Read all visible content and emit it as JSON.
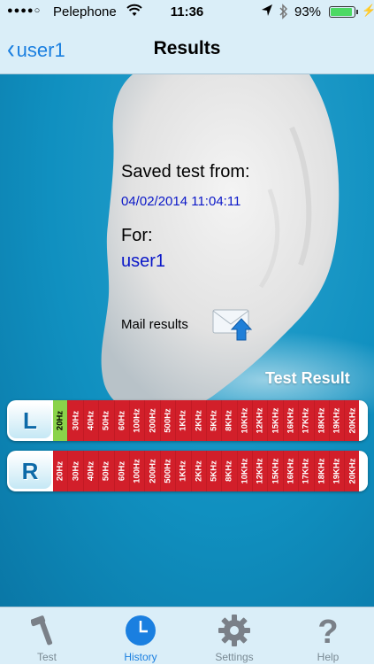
{
  "status_bar": {
    "signal": "●●●●○",
    "carrier": "Pelephone",
    "time": "11:36",
    "battery_pct": "93%",
    "battery_level": 0.93
  },
  "nav": {
    "back_label": "user1",
    "title": "Results"
  },
  "saved": {
    "heading": "Saved test from:",
    "datetime": "04/02/2014 11:04:11",
    "for_label": "For:",
    "user": "user1"
  },
  "mail": {
    "label": "Mail results"
  },
  "test_result": {
    "heading": "Test Result",
    "frequencies": [
      "20Hz",
      "30Hz",
      "40Hz",
      "50Hz",
      "60Hz",
      "100Hz",
      "200Hz",
      "500Hz",
      "1KHz",
      "2KHz",
      "5KHz",
      "8KHz",
      "10KHz",
      "12KHz",
      "15KHz",
      "16KHz",
      "17KHz",
      "18KHz",
      "19KHz",
      "20KHz"
    ],
    "left": {
      "label": "L",
      "heard": [
        "20Hz"
      ]
    },
    "right": {
      "label": "R",
      "heard": []
    }
  },
  "colors": {
    "heard": "#8ad34a",
    "not_heard": "#d21f2a",
    "accent": "#1a7fe0",
    "date_text": "#0a17c8"
  },
  "tabs": [
    {
      "label": "Test",
      "icon": "hammer-icon",
      "active": false
    },
    {
      "label": "History",
      "icon": "clock-icon",
      "active": true
    },
    {
      "label": "Settings",
      "icon": "gear-icon",
      "active": false
    },
    {
      "label": "Help",
      "icon": "question-icon",
      "active": false
    }
  ]
}
